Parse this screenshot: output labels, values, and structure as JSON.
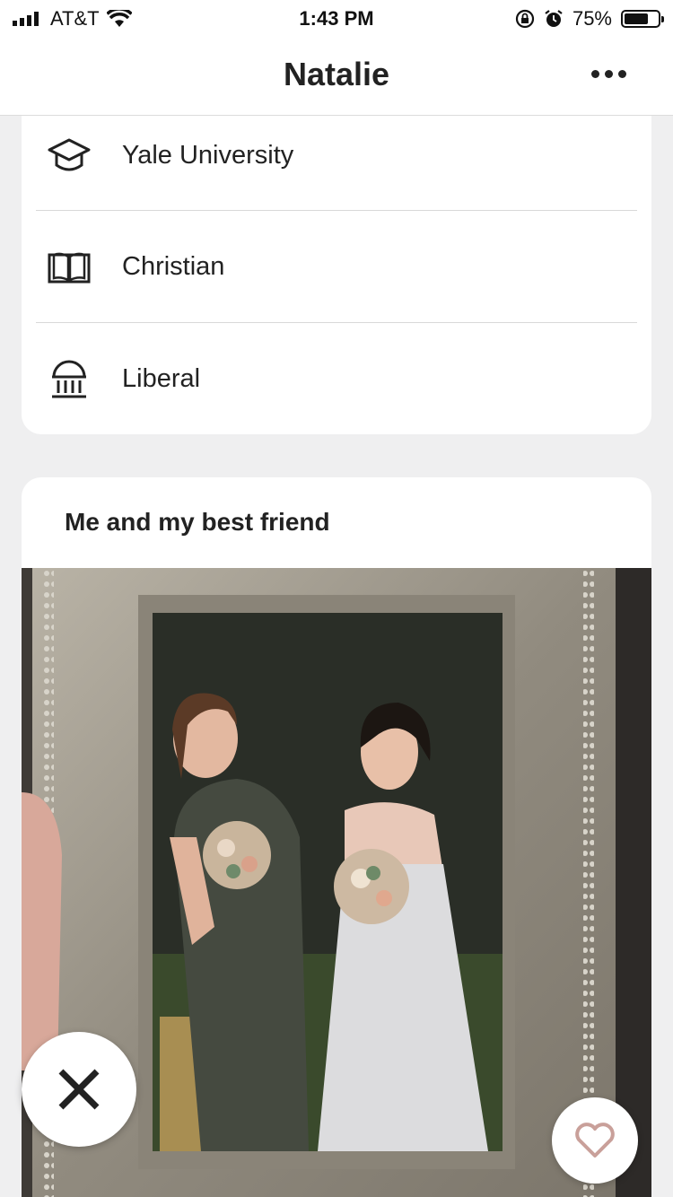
{
  "status_bar": {
    "carrier": "AT&T",
    "time": "1:43 PM",
    "battery_percent": "75%",
    "battery_level": 0.75
  },
  "header": {
    "title": "Natalie",
    "more_icon": "ellipsis-icon"
  },
  "profile_info": [
    {
      "icon": "graduation-cap-icon",
      "label": "Yale University"
    },
    {
      "icon": "book-icon",
      "label": "Christian"
    },
    {
      "icon": "capitol-building-icon",
      "label": "Liberal"
    }
  ],
  "photo_card": {
    "prompt": "Me and my best friend"
  },
  "actions": {
    "reject_icon": "x-icon",
    "like_icon": "heart-icon",
    "like_color": "#c9a09a"
  }
}
